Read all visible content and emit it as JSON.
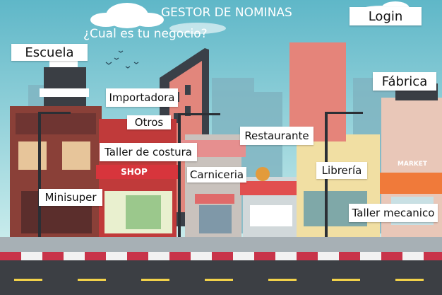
{
  "header": {
    "title": "GESTOR DE NOMINAS",
    "subtitle": "¿Cual es tu negocio?"
  },
  "login_label": "Login",
  "businesses": [
    "Escuela",
    "Importadora",
    "Otros",
    "Taller de costura",
    "Minisuper",
    "Restaurante",
    "Carniceria",
    "Librería",
    "Fábrica",
    "Taller mecanico"
  ],
  "sign_texts": {
    "shop": "SHOP",
    "market": "MARKET"
  },
  "colors": {
    "sky": "#9fd8df",
    "road": "#3c3f44",
    "sidewalk": "#a7b0b5",
    "curb_red": "#c8344a",
    "curb_white": "#f2f2f2"
  }
}
